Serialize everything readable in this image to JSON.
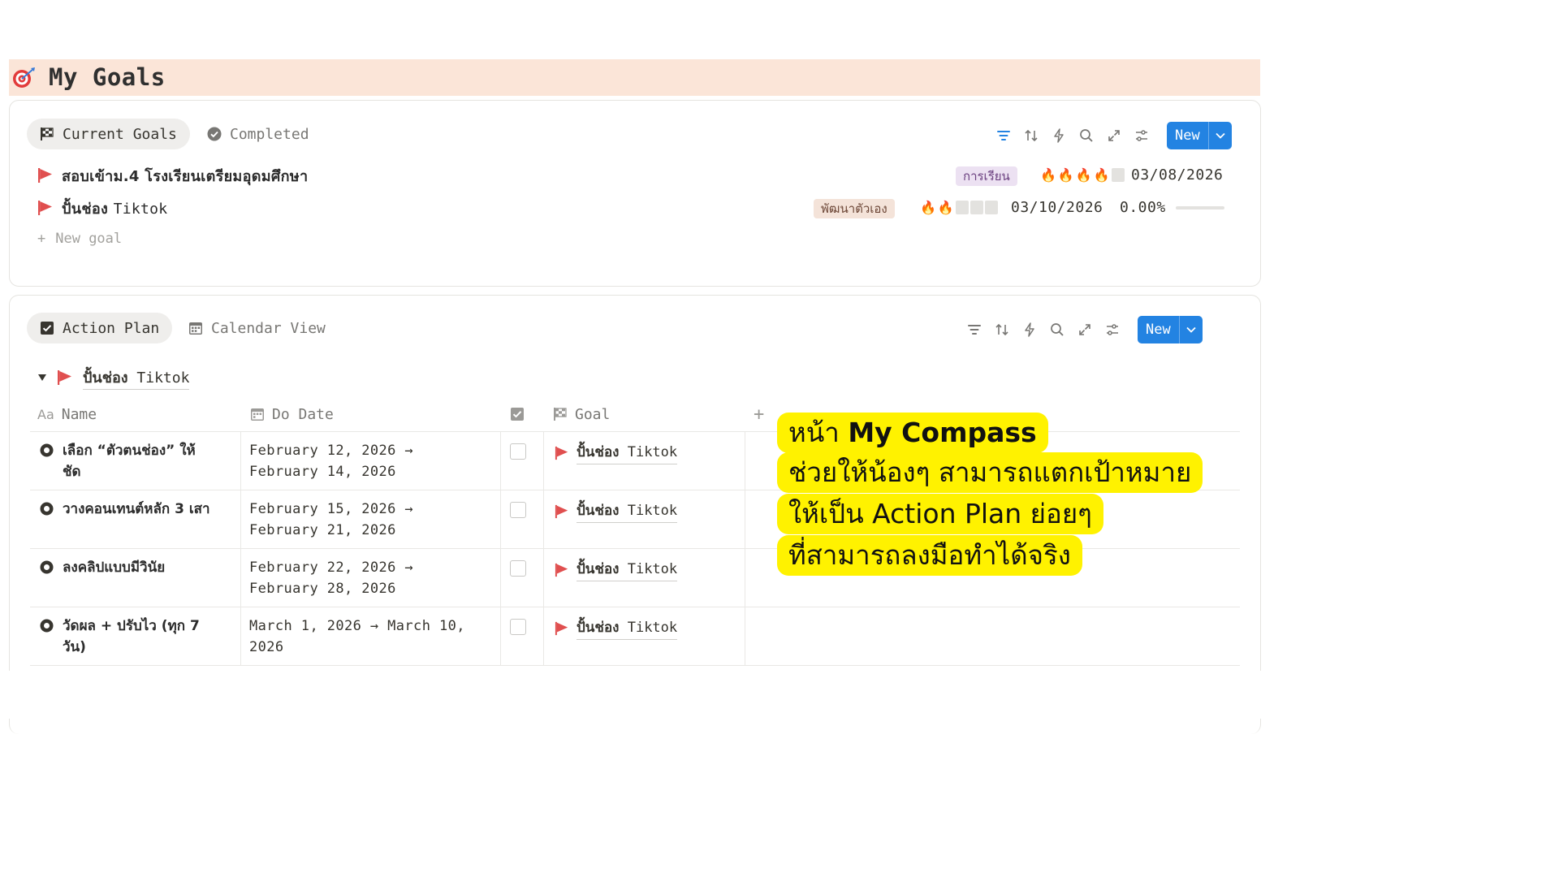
{
  "page": {
    "title": "My Goals",
    "title_icon": "target-dart-icon"
  },
  "goals_panel": {
    "tabs": [
      {
        "label": "Current Goals",
        "icon": "checkered-flag-icon",
        "active": true
      },
      {
        "label": "Completed",
        "icon": "check-circle-icon",
        "active": false
      }
    ],
    "toolbar": {
      "icons": [
        "filter-icon",
        "sort-icon",
        "lightning-icon",
        "search-icon",
        "expand-icon",
        "settings-sliders-icon"
      ],
      "new_label": "New"
    },
    "rows": [
      {
        "title_thai": "สอบเข้าม.4 โรงเรียนเตรียมอุดมศึกษา",
        "tag": "การเรียน",
        "fire_filled": 4,
        "fire_total": 5,
        "date": "03/08/2026",
        "progress": ""
      },
      {
        "title_thai": "ปั้นช่อง",
        "title_latin": "Tiktok",
        "tag": "พัฒนาตัวเอง",
        "fire_filled": 2,
        "fire_total": 5,
        "date": "03/10/2026",
        "progress": "0.00%"
      }
    ],
    "new_goal_label": "New goal"
  },
  "actions_panel": {
    "tabs": [
      {
        "label": "Action Plan",
        "icon": "checkbox-icon",
        "active": true
      },
      {
        "label": "Calendar View",
        "icon": "calendar-icon",
        "active": false
      }
    ],
    "toolbar": {
      "new_label": "New"
    },
    "group": {
      "label_thai": "ปั้นช่อง",
      "label_latin": "Tiktok"
    },
    "columns": {
      "name": "Name",
      "do_date": "Do Date",
      "goal": "Goal"
    },
    "rows": [
      {
        "name_l1": "เลือก “ตัวตนช่อง” ให้",
        "name_l2": "ชัด",
        "date_l1": "February 12, 2026 →",
        "date_l2": "February 14, 2026",
        "goal_thai": "ปั้นช่อง",
        "goal_latin": "Tiktok",
        "done": false
      },
      {
        "name_l1": "วางคอนเทนต์หลัก 3 เสา",
        "name_l2": "",
        "date_l1": "February 15, 2026 →",
        "date_l2": "February 21, 2026",
        "goal_thai": "ปั้นช่อง",
        "goal_latin": "Tiktok",
        "done": false
      },
      {
        "name_l1": "ลงคลิปแบบมีวินัย",
        "name_l2": "",
        "date_l1": "February 22, 2026 →",
        "date_l2": "February 28, 2026",
        "goal_thai": "ปั้นช่อง",
        "goal_latin": "Tiktok",
        "done": false
      },
      {
        "name_l1": "วัดผล + ปรับไว (ทุก 7",
        "name_l2": "วัน)",
        "date_l1": "March 1, 2026 → March 10,",
        "date_l2": "2026",
        "goal_thai": "ปั้นช่อง",
        "goal_latin": "Tiktok",
        "done": false
      }
    ]
  },
  "callout": {
    "line1_prefix": "หน้า ",
    "line1_bold": "My Compass",
    "line2": "ช่วยให้น้องๆ สามารถแตกเป้าหมาย",
    "line3": "ให้เป็น Action Plan ย่อยๆ",
    "line4": "ที่สามารถลงมือทำได้จริง",
    "color": "#fff200"
  },
  "colors": {
    "accent_blue": "#2383e2",
    "flag_red": "#e04f4f",
    "header_peach": "#fbe5d8"
  }
}
